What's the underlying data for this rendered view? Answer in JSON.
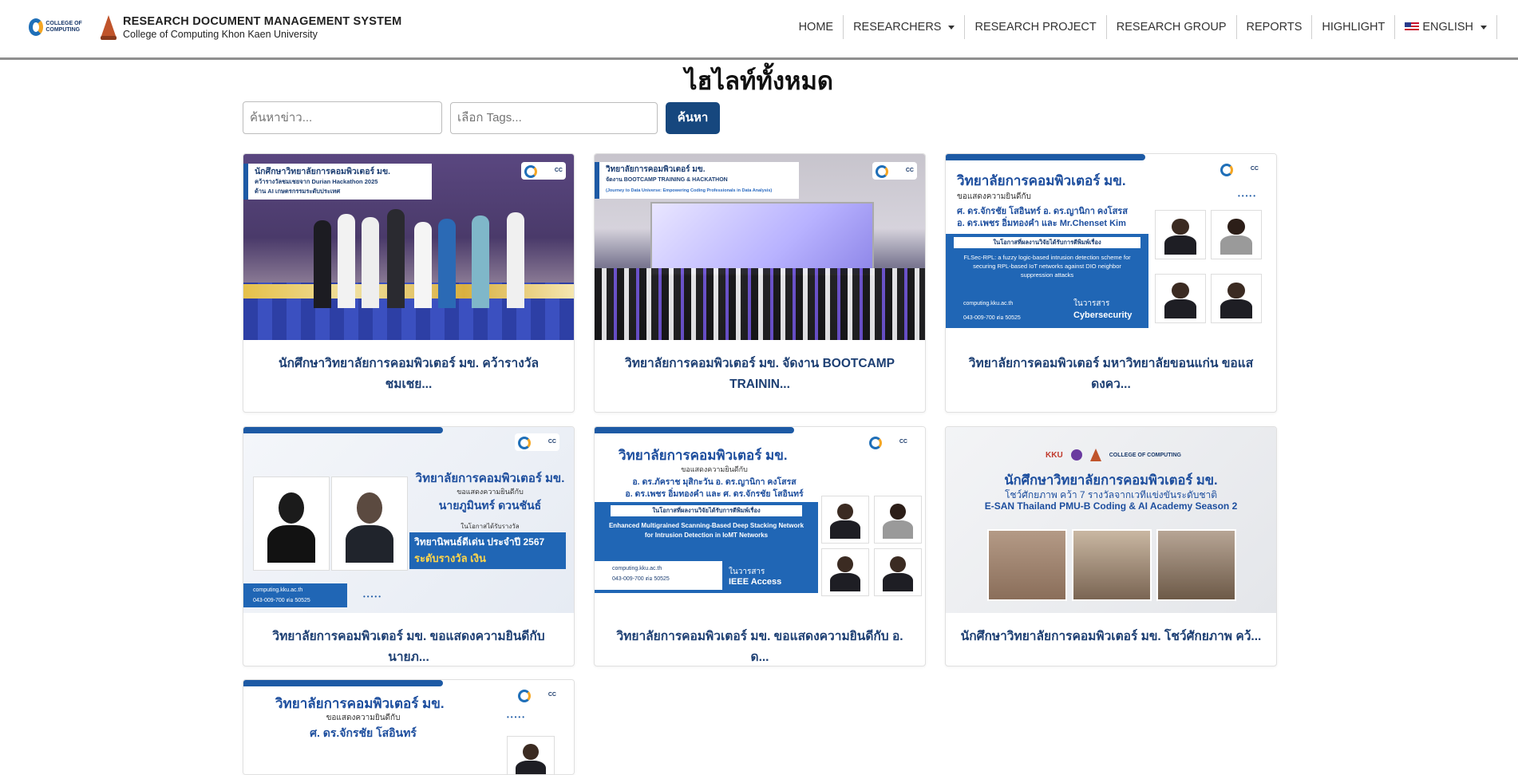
{
  "header": {
    "system_title": "RESEARCH DOCUMENT MANAGEMENT SYSTEM",
    "subtitle": "College of Computing Khon Kaen University",
    "logo_text": "COLLEGE OF COMPUTING",
    "nav": [
      {
        "label": "HOME"
      },
      {
        "label": "RESEARCHERS"
      },
      {
        "label": "RESEARCH PROJECT"
      },
      {
        "label": "RESEARCH GROUP"
      },
      {
        "label": "REPORTS"
      },
      {
        "label": "HIGHLIGHT"
      },
      {
        "label": "ENGLISH"
      }
    ]
  },
  "page": {
    "title": "ไฮไลท์ทั้งหมด",
    "search_placeholder": "ค้นหาข่าว...",
    "tags_placeholder": "เลือก Tags...",
    "search_button": "ค้นหา"
  },
  "cards": [
    {
      "title": "นักศึกษาวิทยาลัยการคอมพิวเตอร์ มข. คว้ารางวัลชมเชย...",
      "poster": {
        "heading": "นักศึกษาวิทยาลัยการคอมพิวเตอร์ มข.",
        "line1": "คว้ารางวัลชมเชยจาก Durian Hackathon 2025",
        "line2": "ด้าน AI เกษตรกรรมระดับประเทศ"
      }
    },
    {
      "title": "วิทยาลัยการคอมพิวเตอร์ มข. จัดงาน BOOTCAMP TRAININ...",
      "poster": {
        "heading": "วิทยาลัยการคอมพิวเตอร์ มข.",
        "line1": "จัดงาน BOOTCAMP TRAINING & HACKATHON",
        "line2": "(Journey to Data Universe: Empowering Coding Professionals in Data Analysis)"
      }
    },
    {
      "title": "วิทยาลัยการคอมพิวเตอร์ มหาวิทยาลัยขอนแก่น ขอแสดงคว...",
      "poster": {
        "heading": "วิทยาลัยการคอมพิวเตอร์ มข.",
        "line1": "ขอแสดงความยินดีกับ",
        "line2": "ศ. ดร.จักรชัย โสอินทร์  อ. ดร.ญานิกา คงโสรส",
        "line3": "อ. ดร.เพชร อิ่มทองคำ และ Mr.Chenset Kim",
        "line4": "ในโอกาสที่ผลงานวิจัยได้รับการตีพิมพ์เรื่อง",
        "paper": "FLSec-RPL: a fuzzy logic-based intrusion detection scheme for securing RPL-based IoT networks against DIO neighbor suppression attacks",
        "journal_label": "ในวารสาร",
        "journal": "Cybersecurity",
        "web": "computing.kku.ac.th",
        "phone": "043-009-700 ต่อ 50525"
      }
    },
    {
      "title": "วิทยาลัยการคอมพิวเตอร์ มข. ขอแสดงความยินดีกับ นายภ...",
      "poster": {
        "heading": "วิทยาลัยการคอมพิวเตอร์ มข.",
        "line1": "ขอแสดงความยินดีกับ",
        "line2": "นายภูมินทร์ ดวนชันธ์",
        "line3": "ในโอกาสได้รับรางวัล",
        "award": "วิทยานิพนธ์ดีเด่น ประจำปี 2567",
        "award2": "ระดับรางวัล เงิน",
        "web": "computing.kku.ac.th",
        "phone": "043-009-700 ต่อ 50525"
      }
    },
    {
      "title": "วิทยาลัยการคอมพิวเตอร์ มข. ขอแสดงความยินดีกับ อ. ด...",
      "poster": {
        "heading": "วิทยาลัยการคอมพิวเตอร์ มข.",
        "line1": "ขอแสดงความยินดีกับ",
        "line2": "อ. ดร.ภัคราช มุสิกะวัน อ. ดร.ญานิกา คงโสรส",
        "line3": "อ. ดร.เพชร อิ่มทองคำ และ ศ. ดร.จักรชัย โสอินทร์",
        "line4": "ในโอกาสที่ผลงานวิจัยได้รับการตีพิมพ์เรื่อง",
        "paper": "Enhanced Multigrained Scanning-Based Deep Stacking Network for Intrusion Detection in IoMT Networks",
        "journal_label": "ในวารสาร",
        "journal": "IEEE Access",
        "web": "computing.kku.ac.th",
        "phone": "043-009-700 ต่อ 50525"
      }
    },
    {
      "title": "นักศึกษาวิทยาลัยการคอมพิวเตอร์ มข. โชว์ศักยภาพ คว้...",
      "poster": {
        "heading": "นักศึกษาวิทยาลัยการคอมพิวเตอร์ มข.",
        "line1": "โชว์ศักยภาพ คว้า 7 รางวัลจากเวทีแข่งขันระดับชาติ",
        "line2": "E-SAN Thailand PMU-B Coding & AI Academy Season 2"
      }
    },
    {
      "title": "",
      "poster": {
        "heading": "วิทยาลัยการคอมพิวเตอร์ มข.",
        "line1": "ขอแสดงความยินดีกับ",
        "line2": "ศ. ดร.จักรชัย โสอินทร์"
      }
    }
  ],
  "colors": {
    "accent": "#16477e",
    "card_title": "#1d3f73",
    "poster_blue": "#2066b5"
  }
}
